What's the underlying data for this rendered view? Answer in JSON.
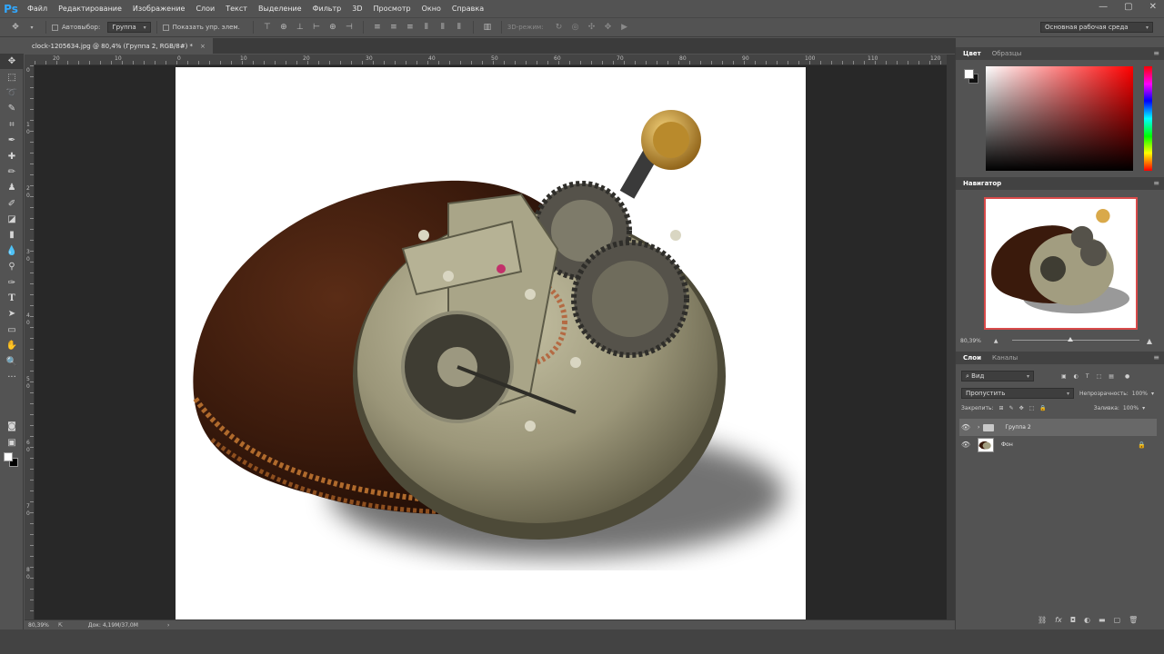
{
  "app": {
    "logo": "Ps"
  },
  "menu": [
    "Файл",
    "Редактирование",
    "Изображение",
    "Слои",
    "Текст",
    "Выделение",
    "Фильтр",
    "3D",
    "Просмотр",
    "Окно",
    "Справка"
  ],
  "options": {
    "autoselect_label": "Автовыбор:",
    "autoselect_value": "Группа",
    "show_controls_label": "Показать упр. элем.",
    "mode3d_label": "3D-режим:",
    "workspace": "Основная рабочая среда"
  },
  "document": {
    "tab_title": "clock-1205634.jpg @ 80,4% (Группа 2, RGB/8#) *",
    "close": "×"
  },
  "rulers": {
    "h": [
      "20",
      "10",
      "0",
      "10",
      "20",
      "30",
      "40",
      "50",
      "60",
      "70",
      "80",
      "90",
      "100",
      "110",
      "120"
    ],
    "v": [
      "0",
      "1",
      "0",
      "2",
      "0",
      "3",
      "0",
      "4",
      "0",
      "5",
      "0",
      "6",
      "0",
      "7",
      "0",
      "8",
      "0"
    ]
  },
  "status": {
    "zoom": "80,39%",
    "doc_info": "Док: 4,19M/37,0M",
    "arrow": "›"
  },
  "panels": {
    "color_tabs": [
      "Цвет",
      "Образцы"
    ],
    "navigator_tab": "Навигатор",
    "navigator_zoom": "80,39%",
    "layers_tabs": [
      "Слои",
      "Каналы"
    ],
    "filter_kind": "Вид",
    "blend_mode": "Пропустить",
    "opacity_label": "Непрозрачность:",
    "opacity_value": "100%",
    "lock_label": "Закрепить:",
    "fill_label": "Заливка:",
    "fill_value": "100%",
    "layers": [
      {
        "name": "Группа 2",
        "type": "group",
        "selected": true
      },
      {
        "name": "Фон",
        "type": "background",
        "locked": true
      }
    ]
  }
}
